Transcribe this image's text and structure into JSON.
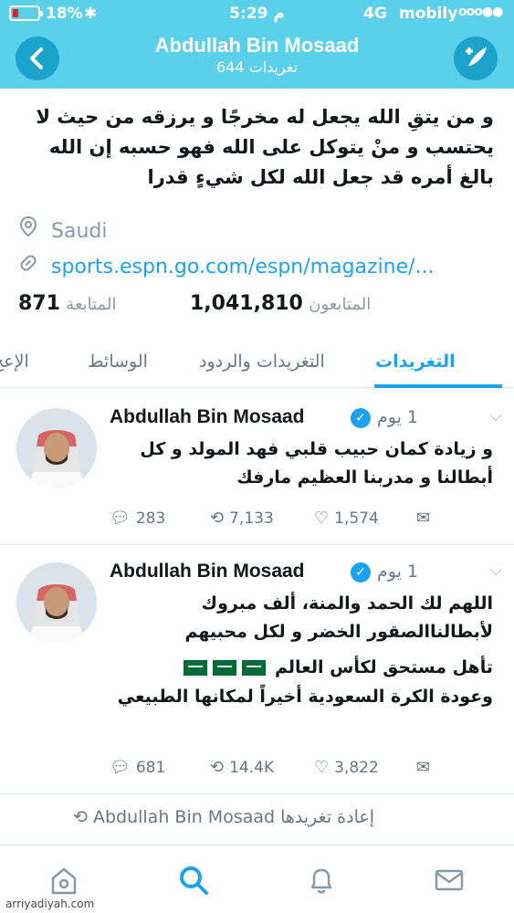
{
  "status_bar": {
    "battery": "18%",
    "time": "5:29 م",
    "network": "4G",
    "carrier": "mobily",
    "signal": "ooo●●"
  },
  "header": {
    "name": "Abdullah Bin Mosaad",
    "tweet_count": "644 تغريدات"
  },
  "profile": {
    "bio": "و من يتقِ الله يجعل له مخرجًا و يرزقه من حيث لا يحتسب و منْ يتوكل على الله فهو حسبه إن الله بالغ أمره قد جعل الله لكل شيءٍ قدرا",
    "location": "Saudi",
    "link": "sports.espn.go.com/espn/magazine/...",
    "following_count": "871",
    "following_label": "المتابعة",
    "followers_count": "1,041,810",
    "followers_label": "المتابعون"
  },
  "tabs": [
    {
      "label": "التغريدات"
    },
    {
      "label": "التغريدات والردود"
    },
    {
      "label": "الوسائط"
    },
    {
      "label": "الإعج"
    }
  ],
  "tweets": [
    {
      "name": "Abdullah Bin Mosaad",
      "time": "1 يوم",
      "text": "و زيادة كمان حبيب قلبي فهد المولد و كل أبطالنا و مدربنا العظيم مارفك",
      "replies": "283",
      "retweets": "7,133",
      "likes": "1,574"
    },
    {
      "name": "Abdullah Bin Mosaad",
      "time": "1 يوم",
      "text_line1": "اللهم لك الحمد والمنة، ألف مبروك لأبطالناالصقور الخضر و لكل محبيهم",
      "text_line2": "تأهل مستحق لكأس العالم",
      "text_line3": "وعودة الكرة السعودية أخيراً لمكانها الطبيعي",
      "replies": "681",
      "retweets": "14.4K",
      "likes": "3,822"
    }
  ],
  "retweet_notice": "Abdullah Bin Mosaad إعادة تغريدها",
  "watermark": "arriyadiyah.com",
  "colors": {
    "header_bg": "#5bd0ea",
    "accent": "#1da1f2",
    "muted": "#657786"
  }
}
